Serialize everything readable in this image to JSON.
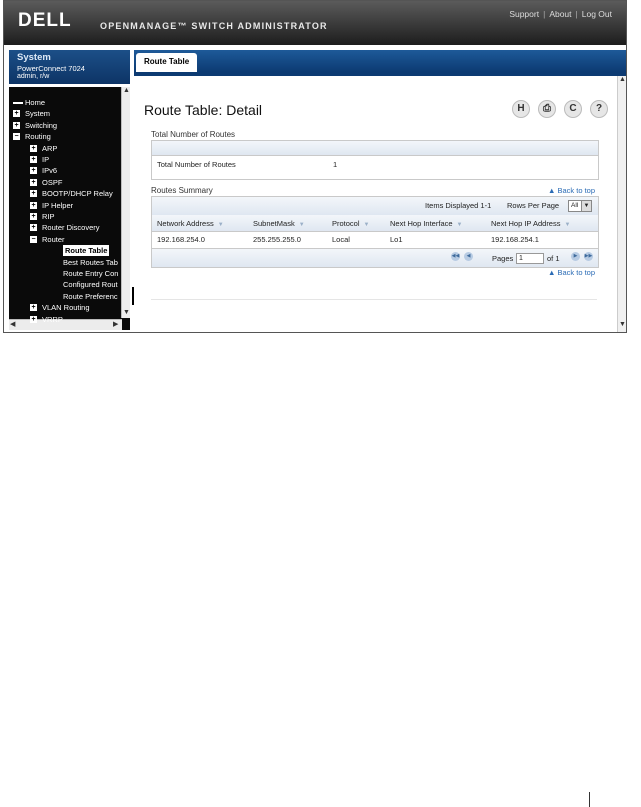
{
  "header": {
    "logo": "DELL",
    "app_name": "OPENMANAGE™ SWITCH ADMINISTRATOR",
    "links": [
      "Support",
      "About",
      "Log Out"
    ]
  },
  "system": {
    "title": "System",
    "model": "PowerConnect 7024",
    "user": "admin, r/w"
  },
  "nav": {
    "items": [
      {
        "label": "Home",
        "indent": 0,
        "toggle": "line"
      },
      {
        "label": "System",
        "indent": 0,
        "toggle": "+"
      },
      {
        "label": "Switching",
        "indent": 0,
        "toggle": "+"
      },
      {
        "label": "Routing",
        "indent": 0,
        "toggle": "-"
      },
      {
        "label": "ARP",
        "indent": 1,
        "toggle": "+"
      },
      {
        "label": "IP",
        "indent": 1,
        "toggle": "+"
      },
      {
        "label": "IPv6",
        "indent": 1,
        "toggle": "+"
      },
      {
        "label": "OSPF",
        "indent": 1,
        "toggle": "+"
      },
      {
        "label": "BOOTP/DHCP Relay",
        "indent": 1,
        "toggle": "+"
      },
      {
        "label": "IP Helper",
        "indent": 1,
        "toggle": "+"
      },
      {
        "label": "RIP",
        "indent": 1,
        "toggle": "+"
      },
      {
        "label": "Router Discovery",
        "indent": 1,
        "toggle": "+"
      },
      {
        "label": "Router",
        "indent": 1,
        "toggle": "-"
      },
      {
        "label": "Route Table",
        "indent": 2,
        "toggle": "",
        "selected": true
      },
      {
        "label": "Best Routes Tab",
        "indent": 2,
        "toggle": ""
      },
      {
        "label": "Route Entry Con",
        "indent": 2,
        "toggle": ""
      },
      {
        "label": "Configured Rout",
        "indent": 2,
        "toggle": ""
      },
      {
        "label": "Route Preferenc",
        "indent": 2,
        "toggle": ""
      },
      {
        "label": "VLAN Routing",
        "indent": 1,
        "toggle": "+"
      },
      {
        "label": "VRRP",
        "indent": 1,
        "toggle": "+"
      }
    ]
  },
  "tab": {
    "label": "Route Table"
  },
  "page": {
    "title": "Route Table: Detail",
    "icons": [
      "save-icon",
      "print-icon",
      "refresh-icon",
      "help-icon"
    ],
    "icon_glyphs": [
      "H",
      "⎙",
      "C",
      "?"
    ]
  },
  "total_section": {
    "title": "Total Number of Routes",
    "row_label": "Total Number of Routes",
    "row_value": "1"
  },
  "summary": {
    "title": "Routes Summary",
    "back_to_top": "▲ Back to top",
    "items_displayed": "Items Displayed 1-1",
    "rows_per_page_label": "Rows Per Page",
    "rows_per_page_value": "All",
    "columns": [
      "Network Address",
      "SubnetMask",
      "Protocol",
      "Next Hop Interface",
      "Next Hop IP Address"
    ],
    "rows": [
      [
        "192.168.254.0",
        "255.255.255.0",
        "Local",
        "Lo1",
        "192.168.254.1"
      ]
    ],
    "pages_label": "Pages",
    "page_value": "1",
    "of_label": "of 1",
    "back_to_top_bottom": "▲ Back to top"
  },
  "colors": {
    "nav_bg": "#0a0a0a",
    "tab_blue": "#0c3a72",
    "link": "#2a6bb5"
  }
}
